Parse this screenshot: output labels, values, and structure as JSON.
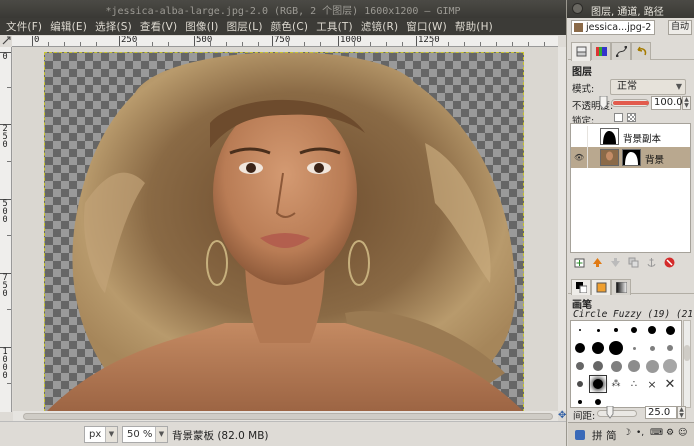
{
  "window": {
    "title": "*jessica-alba-large.jpg-2.0 (RGB, 2 个图层) 1600x1200 – GIMP"
  },
  "menu": [
    {
      "label": "文件(F)"
    },
    {
      "label": "编辑(E)"
    },
    {
      "label": "选择(S)"
    },
    {
      "label": "查看(V)"
    },
    {
      "label": "图像(I)"
    },
    {
      "label": "图层(L)"
    },
    {
      "label": "颜色(C)"
    },
    {
      "label": "工具(T)"
    },
    {
      "label": "滤镜(R)"
    },
    {
      "label": "窗口(W)"
    },
    {
      "label": "帮助(H)"
    }
  ],
  "ruler": {
    "h_labels": [
      "0",
      "250",
      "500",
      "750",
      "1000",
      "1250"
    ],
    "v_labels": [
      "0",
      "250",
      "500",
      "750",
      "1000"
    ]
  },
  "status": {
    "unit": "px",
    "zoom": "50 %",
    "message": "背景蒙板 (82.0 MB)"
  },
  "dock": {
    "title": "图层, 通道, 路径",
    "image_selector": "jessica...jpg-2",
    "auto_label": "自动",
    "layers_title": "图层",
    "mode_label": "模式:",
    "mode_value": "正常",
    "opacity_label": "不透明度:",
    "opacity_value": "100.0",
    "opacity_level": 1.0,
    "lock_label": "锁定:",
    "layers": [
      {
        "name": "背景副本",
        "visible": false,
        "selected": false
      },
      {
        "name": "背景",
        "visible": true,
        "selected": true
      }
    ],
    "brushes_title": "画笔",
    "brush_name": "Circle Fuzzy (19) (21",
    "spacing_label": "间距:",
    "spacing_value": "25.0",
    "spacing_level": 0.25,
    "tray": [
      "拼",
      "简"
    ]
  },
  "colors": {
    "accent": "#e25b4d",
    "selected_layer": "#b9a88f",
    "titlebar": "#3c3b37"
  }
}
